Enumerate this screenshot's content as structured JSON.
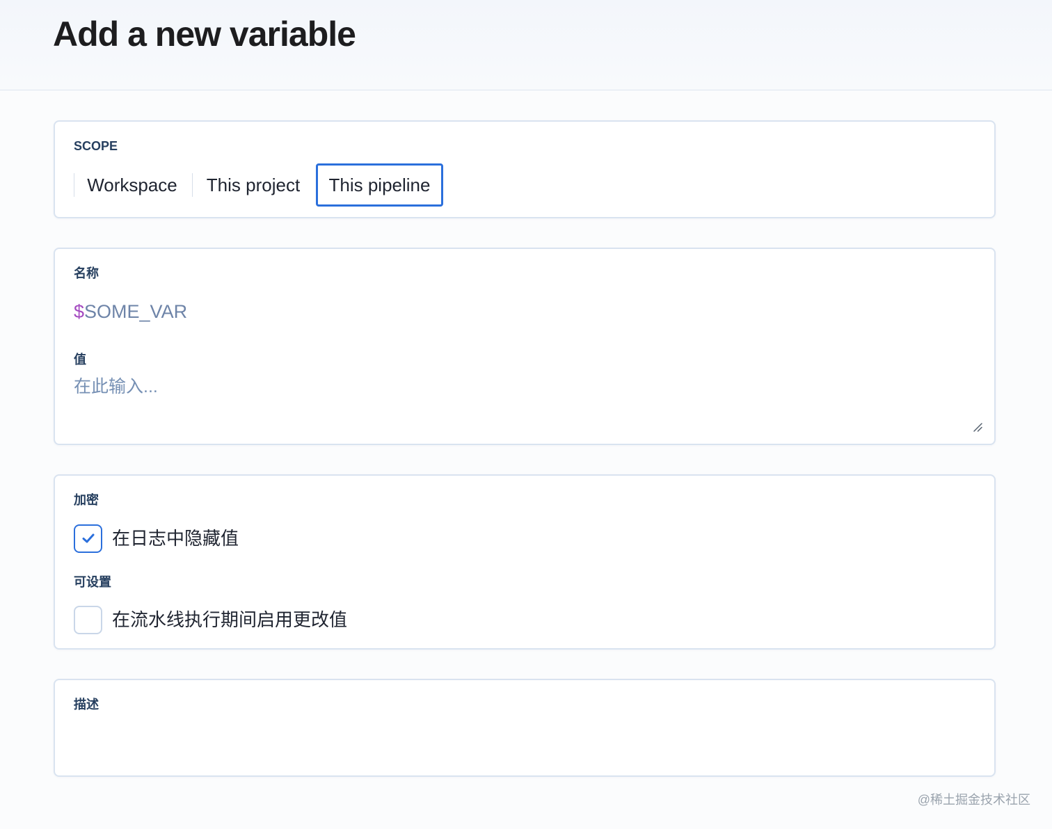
{
  "page": {
    "title": "Add a new variable"
  },
  "scope": {
    "label": "SCOPE",
    "tabs": [
      {
        "label": "Workspace"
      },
      {
        "label": "This project"
      },
      {
        "label": "This pipeline"
      }
    ],
    "selected": "This pipeline"
  },
  "name_field": {
    "label": "名称",
    "sigil": "$",
    "value": "SOME_VAR"
  },
  "value_field": {
    "label": "值",
    "placeholder": "在此输入..."
  },
  "encryption": {
    "label": "加密",
    "hide_option": {
      "label": "在日志中隐藏值",
      "checked": true
    }
  },
  "settable": {
    "label": "可设置",
    "change_option": {
      "label": "在流水线执行期间启用更改值",
      "checked": false
    }
  },
  "description": {
    "label": "描述"
  },
  "watermark": "@稀土掘金技术社区",
  "colors": {
    "accent": "#2b6fdc",
    "sigil": "#a44ac0",
    "label": "#263f5f",
    "placeholder": "#7690b4"
  },
  "icons": {
    "checkmark": "check-icon",
    "resize": "resize-handle-icon"
  }
}
